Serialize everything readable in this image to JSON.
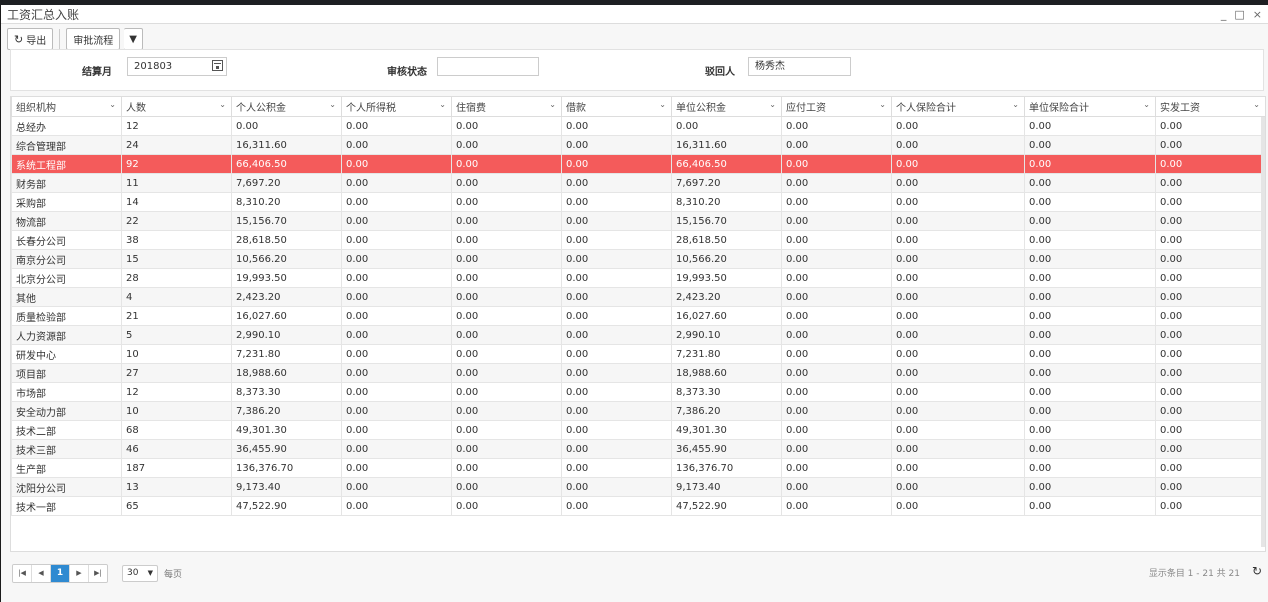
{
  "window": {
    "title": "工资汇总入账",
    "controls": [
      "_",
      "□",
      "×"
    ]
  },
  "toolbar": {
    "export_label": "导出",
    "approval_label": "审批流程",
    "approval_caret": "▼"
  },
  "filters": {
    "month_label": "结算月",
    "month_value": "201803",
    "status_label": "审核状态",
    "status_value": "",
    "rejector_label": "驳回人",
    "rejector_value": "杨秀杰"
  },
  "table": {
    "columns": [
      "组织机构",
      "人数",
      "个人公积金",
      "个人所得税",
      "住宿费",
      "借款",
      "单位公积金",
      "应付工资",
      "个人保险合计",
      "单位保险合计",
      "实发工资"
    ],
    "rows": [
      [
        "总经办",
        "12",
        "0.00",
        "0.00",
        "0.00",
        "0.00",
        "0.00",
        "0.00",
        "0.00",
        "0.00",
        "0.00"
      ],
      [
        "综合管理部",
        "24",
        "16,311.60",
        "0.00",
        "0.00",
        "0.00",
        "16,311.60",
        "0.00",
        "0.00",
        "0.00",
        "0.00"
      ],
      [
        "系统工程部",
        "92",
        "66,406.50",
        "0.00",
        "0.00",
        "0.00",
        "66,406.50",
        "0.00",
        "0.00",
        "0.00",
        "0.00"
      ],
      [
        "财务部",
        "11",
        "7,697.20",
        "0.00",
        "0.00",
        "0.00",
        "7,697.20",
        "0.00",
        "0.00",
        "0.00",
        "0.00"
      ],
      [
        "采购部",
        "14",
        "8,310.20",
        "0.00",
        "0.00",
        "0.00",
        "8,310.20",
        "0.00",
        "0.00",
        "0.00",
        "0.00"
      ],
      [
        "物流部",
        "22",
        "15,156.70",
        "0.00",
        "0.00",
        "0.00",
        "15,156.70",
        "0.00",
        "0.00",
        "0.00",
        "0.00"
      ],
      [
        "长春分公司",
        "38",
        "28,618.50",
        "0.00",
        "0.00",
        "0.00",
        "28,618.50",
        "0.00",
        "0.00",
        "0.00",
        "0.00"
      ],
      [
        "南京分公司",
        "15",
        "10,566.20",
        "0.00",
        "0.00",
        "0.00",
        "10,566.20",
        "0.00",
        "0.00",
        "0.00",
        "0.00"
      ],
      [
        "北京分公司",
        "28",
        "19,993.50",
        "0.00",
        "0.00",
        "0.00",
        "19,993.50",
        "0.00",
        "0.00",
        "0.00",
        "0.00"
      ],
      [
        "其他",
        "4",
        "2,423.20",
        "0.00",
        "0.00",
        "0.00",
        "2,423.20",
        "0.00",
        "0.00",
        "0.00",
        "0.00"
      ],
      [
        "质量检验部",
        "21",
        "16,027.60",
        "0.00",
        "0.00",
        "0.00",
        "16,027.60",
        "0.00",
        "0.00",
        "0.00",
        "0.00"
      ],
      [
        "人力资源部",
        "5",
        "2,990.10",
        "0.00",
        "0.00",
        "0.00",
        "2,990.10",
        "0.00",
        "0.00",
        "0.00",
        "0.00"
      ],
      [
        "研发中心",
        "10",
        "7,231.80",
        "0.00",
        "0.00",
        "0.00",
        "7,231.80",
        "0.00",
        "0.00",
        "0.00",
        "0.00"
      ],
      [
        "项目部",
        "27",
        "18,988.60",
        "0.00",
        "0.00",
        "0.00",
        "18,988.60",
        "0.00",
        "0.00",
        "0.00",
        "0.00"
      ],
      [
        "市场部",
        "12",
        "8,373.30",
        "0.00",
        "0.00",
        "0.00",
        "8,373.30",
        "0.00",
        "0.00",
        "0.00",
        "0.00"
      ],
      [
        "安全动力部",
        "10",
        "7,386.20",
        "0.00",
        "0.00",
        "0.00",
        "7,386.20",
        "0.00",
        "0.00",
        "0.00",
        "0.00"
      ],
      [
        "技术二部",
        "68",
        "49,301.30",
        "0.00",
        "0.00",
        "0.00",
        "49,301.30",
        "0.00",
        "0.00",
        "0.00",
        "0.00"
      ],
      [
        "技术三部",
        "46",
        "36,455.90",
        "0.00",
        "0.00",
        "0.00",
        "36,455.90",
        "0.00",
        "0.00",
        "0.00",
        "0.00"
      ],
      [
        "生产部",
        "187",
        "136,376.70",
        "0.00",
        "0.00",
        "0.00",
        "136,376.70",
        "0.00",
        "0.00",
        "0.00",
        "0.00"
      ],
      [
        "沈阳分公司",
        "13",
        "9,173.40",
        "0.00",
        "0.00",
        "0.00",
        "9,173.40",
        "0.00",
        "0.00",
        "0.00",
        "0.00"
      ],
      [
        "技术一部",
        "65",
        "47,522.90",
        "0.00",
        "0.00",
        "0.00",
        "47,522.90",
        "0.00",
        "0.00",
        "0.00",
        "0.00"
      ]
    ],
    "selected_row": 2
  },
  "pager": {
    "first": "|◀",
    "prev": "◀",
    "current_page": "1",
    "next": "▶",
    "last": "▶|",
    "page_size": "30",
    "per_page_label": "每页",
    "info": "显示条目 1 - 21 共 21",
    "refresh": "↻"
  },
  "colors": {
    "selected_row": "#f45b5b",
    "active_page": "#2f8ad1"
  }
}
